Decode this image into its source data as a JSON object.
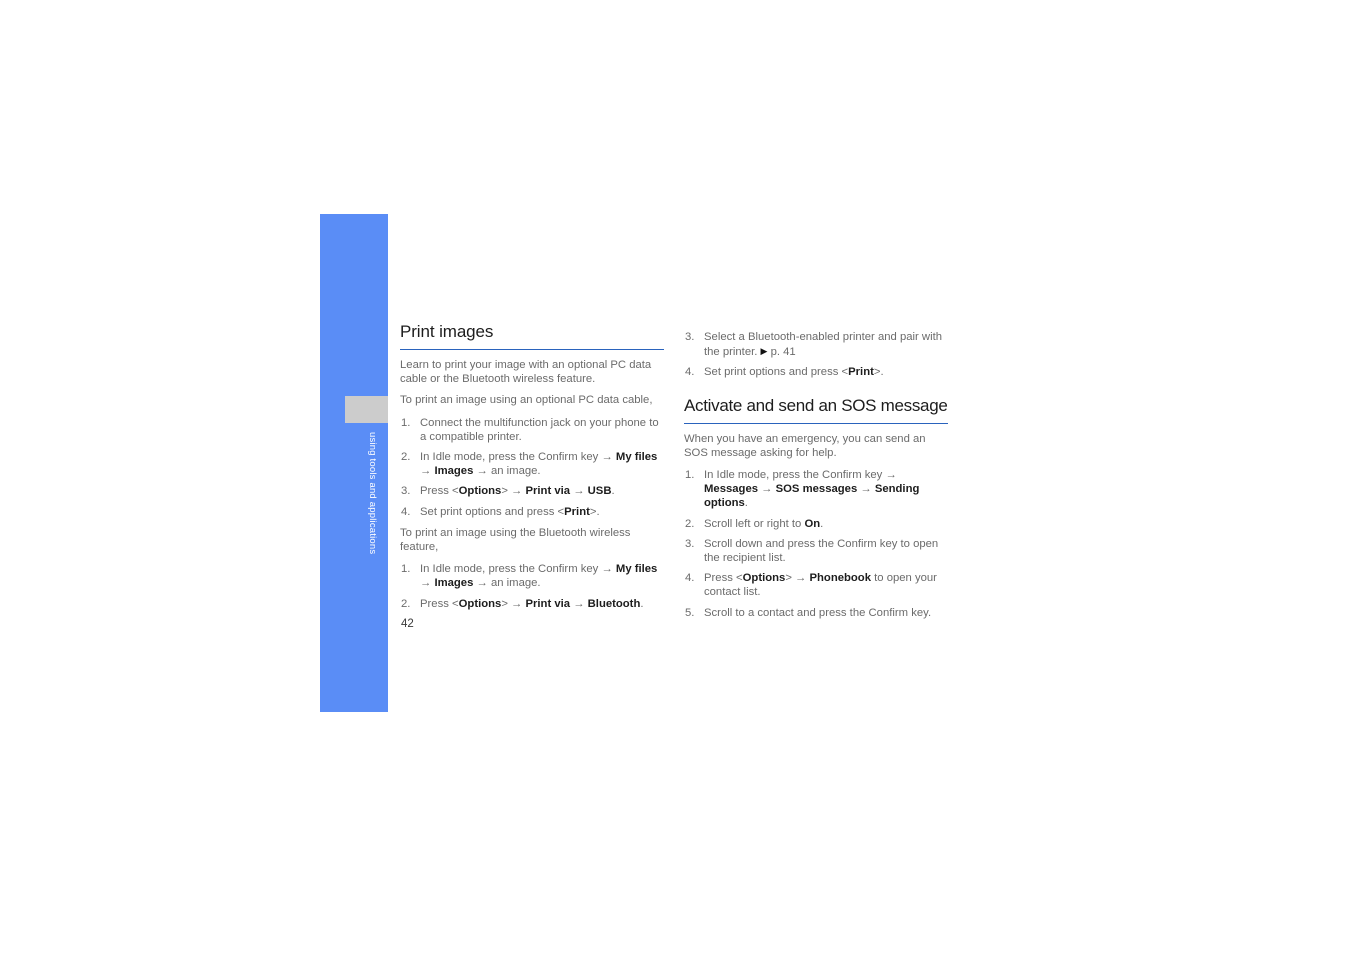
{
  "page": {
    "folio": "42",
    "chapter_label": "using tools and applications",
    "accent_blue": "#5a8df6",
    "rule_blue": "#2a63bd",
    "tab_gray": "#cccccc",
    "body_gray": "#6b6b6b"
  },
  "left_column": {
    "heading": "Print images",
    "intro": "Learn to print your image with an optional PC data cable or the Bluetooth wireless feature.",
    "usb_lead": "To print an image using an optional PC data cable,",
    "usb_steps": [
      {
        "parts": [
          {
            "t": "Connect the multifunction jack on your phone to a compatible printer.",
            "bold": false
          }
        ]
      },
      {
        "parts": [
          {
            "t": "In Idle mode, press the Confirm key ",
            "bold": false
          },
          {
            "t": "→ ",
            "bold": false
          },
          {
            "t": "My files",
            "bold": true
          },
          {
            "t": " → ",
            "bold": false
          },
          {
            "t": "Images",
            "bold": true
          },
          {
            "t": " → an image.",
            "bold": false
          }
        ]
      },
      {
        "parts": [
          {
            "t": "Press <",
            "bold": false
          },
          {
            "t": "Options",
            "bold": true
          },
          {
            "t": "> → ",
            "bold": false
          },
          {
            "t": "Print via",
            "bold": true
          },
          {
            "t": " → ",
            "bold": false
          },
          {
            "t": "USB",
            "bold": true
          },
          {
            "t": ".",
            "bold": false
          }
        ]
      },
      {
        "parts": [
          {
            "t": "Set print options and press <",
            "bold": false
          },
          {
            "t": "Print",
            "bold": true
          },
          {
            "t": ">.",
            "bold": false
          }
        ]
      }
    ],
    "bt_lead": "To print an image using the Bluetooth wireless feature,",
    "bt_steps": [
      {
        "parts": [
          {
            "t": "In Idle mode, press the Confirm key ",
            "bold": false
          },
          {
            "t": "→ ",
            "bold": false
          },
          {
            "t": "My files",
            "bold": true
          },
          {
            "t": " → ",
            "bold": false
          },
          {
            "t": "Images",
            "bold": true
          },
          {
            "t": " → an image.",
            "bold": false
          }
        ]
      },
      {
        "parts": [
          {
            "t": "Press <",
            "bold": false
          },
          {
            "t": "Options",
            "bold": true
          },
          {
            "t": "> → ",
            "bold": false
          },
          {
            "t": "Print via",
            "bold": true
          },
          {
            "t": " → ",
            "bold": false
          },
          {
            "t": "Bluetooth",
            "bold": true
          },
          {
            "t": ".",
            "bold": false
          }
        ]
      }
    ]
  },
  "right_column": {
    "continued_steps_start": 3,
    "continued_steps": [
      {
        "parts": [
          {
            "t": "Select a Bluetooth-enabled printer and pair with the printer. ",
            "bold": false
          },
          {
            "t": "▶",
            "bold": false,
            "cls": "ref-tri"
          },
          {
            "t": " p. 41",
            "bold": false
          }
        ]
      },
      {
        "parts": [
          {
            "t": "Set print options and press <",
            "bold": false
          },
          {
            "t": "Print",
            "bold": true
          },
          {
            "t": ">.",
            "bold": false
          }
        ]
      }
    ],
    "heading": "Activate and send an SOS message",
    "intro": "When you have an emergency, you can send an SOS message asking for help.",
    "sos_steps": [
      {
        "parts": [
          {
            "t": "In Idle mode, press the Confirm key → ",
            "bold": false
          },
          {
            "t": "Messages",
            "bold": true
          },
          {
            "t": " → ",
            "bold": false
          },
          {
            "t": "SOS messages",
            "bold": true
          },
          {
            "t": " → ",
            "bold": false
          },
          {
            "t": "Sending options",
            "bold": true
          },
          {
            "t": ".",
            "bold": false
          }
        ]
      },
      {
        "parts": [
          {
            "t": "Scroll left or right to ",
            "bold": false
          },
          {
            "t": "On",
            "bold": true
          },
          {
            "t": ".",
            "bold": false
          }
        ]
      },
      {
        "parts": [
          {
            "t": "Scroll down and press the Confirm key to open the recipient list.",
            "bold": false
          }
        ]
      },
      {
        "parts": [
          {
            "t": "Press <",
            "bold": false
          },
          {
            "t": "Options",
            "bold": true
          },
          {
            "t": "> → ",
            "bold": false
          },
          {
            "t": "Phonebook",
            "bold": true
          },
          {
            "t": " to open your contact list.",
            "bold": false
          }
        ]
      },
      {
        "parts": [
          {
            "t": "Scroll to a contact and press the Confirm key.",
            "bold": false
          }
        ]
      }
    ]
  }
}
